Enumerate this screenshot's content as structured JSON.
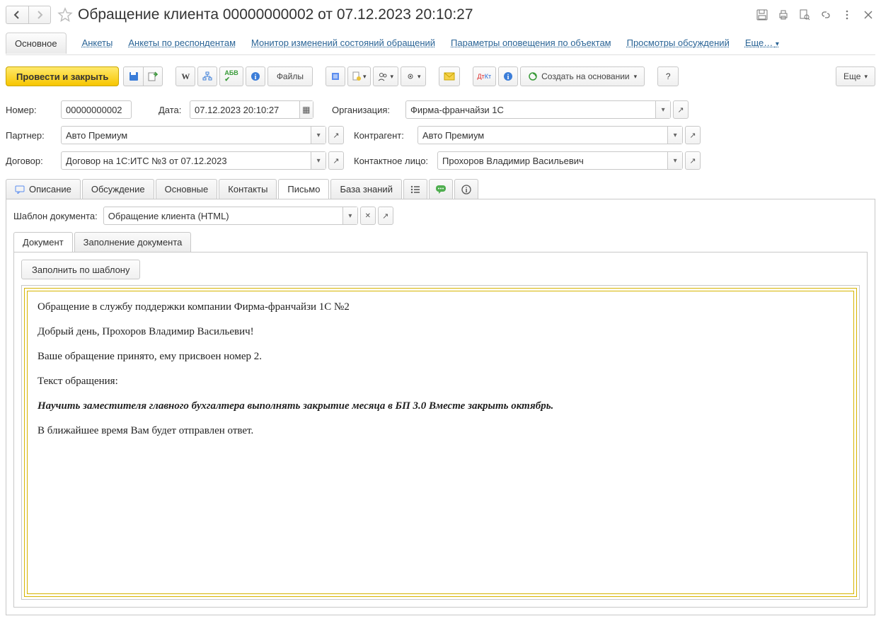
{
  "header": {
    "title": "Обращение клиента 00000000002 от 07.12.2023 20:10:27"
  },
  "nav": {
    "main": "Основное",
    "links": [
      "Анкеты",
      "Анкеты по респондентам",
      "Монитор изменений состояний обращений",
      "Параметры оповещения по объектам",
      "Просмотры обсуждений"
    ],
    "more": "Еще…"
  },
  "toolbar": {
    "post_close": "Провести и закрыть",
    "files": "Файлы",
    "create_based": "Создать на основании",
    "more": "Еще"
  },
  "form": {
    "number_label": "Номер:",
    "number": "00000000002",
    "date_label": "Дата:",
    "date": "07.12.2023 20:10:27",
    "org_label": "Организация:",
    "org": "Фирма-франчайзи 1С",
    "partner_label": "Партнер:",
    "partner": "Авто Премиум",
    "counterparty_label": "Контрагент:",
    "counterparty": "Авто Премиум",
    "contract_label": "Договор:",
    "contract": "Договор на 1С:ИТС №3 от 07.12.2023",
    "contact_label": "Контактное лицо:",
    "contact": "Прохоров Владимир Васильевич"
  },
  "tabs": {
    "describe": "Описание",
    "discuss": "Обсуждение",
    "main": "Основные",
    "contacts": "Контакты",
    "letter": "Письмо",
    "kb": "База знаний"
  },
  "letter_panel": {
    "template_label": "Шаблон документа:",
    "template_value": "Обращение клиента (HTML)",
    "subtab_doc": "Документ",
    "subtab_fill": "Заполнение документа",
    "fill_btn": "Заполнить по шаблону",
    "body": {
      "p1": "Обращение в службу поддержки компании Фирма-франчайзи 1С №2",
      "p2": "Добрый день, Прохоров Владимир Васильевич!",
      "p3": "Ваше обращение принято, ему присвоен номер 2.",
      "p4": "Текст обращения:",
      "p5": "Научить заместителя главного бухгалтера выполнять закрытие месяца в БП 3.0 Вместе закрыть октябрь.",
      "p6": "В ближайшее время Вам будет отправлен ответ."
    }
  },
  "help": "?"
}
